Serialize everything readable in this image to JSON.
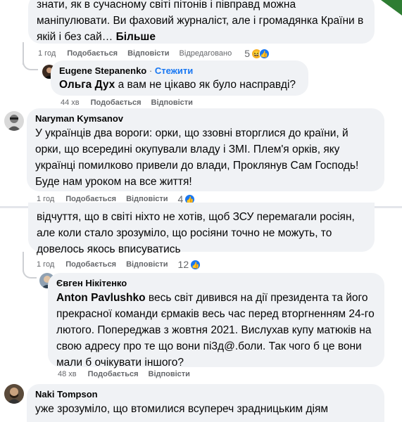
{
  "comments": [
    {
      "text_top": "знати, як в сучасному світі пітонів і півправд можна",
      "text": "маніпулювати. Ви фаховий журналіст, але і громадянка Країни в якій і без сай…",
      "more": "Більше",
      "time": "1 год",
      "like": "Подобається",
      "reply": "Відповісти",
      "edited": "Відредаговано",
      "reactions": "5"
    },
    {
      "author": "Eugene Stepanenko",
      "follow": "Стежити",
      "mention": "Ольга Дух",
      "text": "а вам не цікаво як було насправді?",
      "time": "44 хв",
      "like": "Подобається",
      "reply": "Відповісти"
    },
    {
      "author": "Naryman Kymsanov",
      "text": "У українців два вороги: орки, що ззовні вторглися до країни, й орки, що всередині окупували владу і ЗМІ. Плем'я орків, яку українці помилково привели до влади, Проклянув Сам Господь! Буде нам уроком на все життя!",
      "time": "1 год",
      "like": "Подобається",
      "reply": "Відповісти",
      "reactions": "4"
    },
    {
      "text": "відчуття, що в світі ніхто не хотів, щоб ЗСУ перемагали росіян, але коли стало зрозуміло, що росіяни точно не можуть, то довелось якось вписуватись",
      "time": "1 год",
      "like": "Подобається",
      "reply": "Відповісти",
      "reactions": "12"
    },
    {
      "author": "Євген Нікітенко",
      "mention": "Anton Pavlushko",
      "text": "весь світ дивився на дії президента та його прекрасної команди єрмаків весь час перед вторгненням 24-го лютого. Попереджав з жовтня 2021. Вислухав купу матюків на свою адресу про те що вони пі3д@.боли. Так чого б це вони мали б очікувати іншого?",
      "time": "48 хв",
      "like": "Подобається",
      "reply": "Відповісти"
    },
    {
      "author": "Naki Tompson",
      "text": "уже зрозуміло, що втомилися всупереч зрадницьким діям"
    }
  ],
  "colors": {
    "bubble": "#f0f2f5",
    "meta": "#65676b",
    "link": "#1877f2",
    "like_icon": "#1877f2",
    "haha_icon": "#f7b125"
  }
}
